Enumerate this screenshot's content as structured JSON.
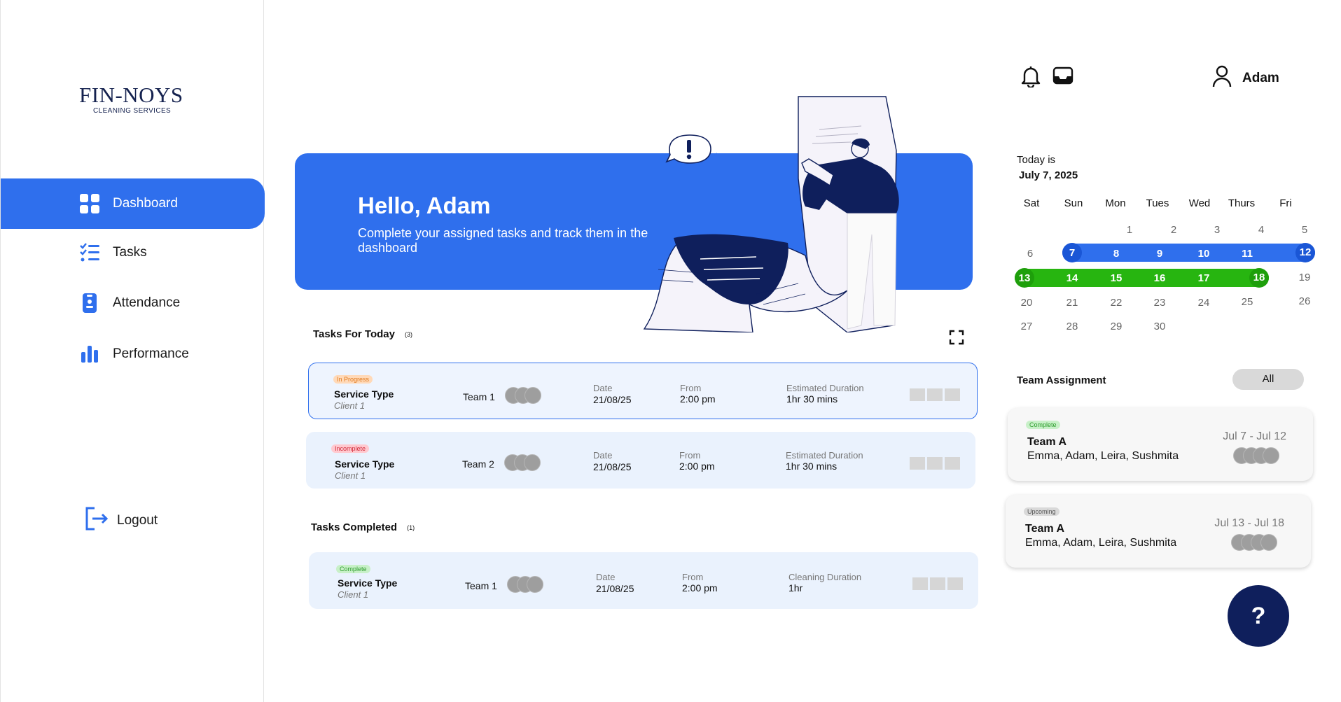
{
  "brand": {
    "name": "FIN-NOYS",
    "tagline": "CLEANING SERVICES"
  },
  "nav": [
    {
      "label": "Dashboard",
      "icon": "grid-icon",
      "active": true
    },
    {
      "label": "Tasks",
      "icon": "checklist-icon"
    },
    {
      "label": "Attendance",
      "icon": "clipboard-icon"
    },
    {
      "label": "Performance",
      "icon": "bar-chart-icon"
    }
  ],
  "logout_label": "Logout",
  "user": {
    "name": "Adam"
  },
  "hero": {
    "greeting": "Hello, Adam",
    "message": "Complete your assigned tasks and track them in the dashboard"
  },
  "tasks_today": {
    "title": "Tasks For Today",
    "count": "(3)",
    "items": [
      {
        "status": "In Progress",
        "service": "Service Type",
        "client": "Client 1",
        "team": "Team 1",
        "date_label": "Date",
        "date": "21/08/25",
        "from_label": "From",
        "from": "2:00 pm",
        "duration_label": "Estimated Duration",
        "duration": "1hr 30 mins"
      },
      {
        "status": "Incomplete",
        "service": "Service Type",
        "client": "Client 1",
        "team": "Team 2",
        "date_label": "Date",
        "date": "21/08/25",
        "from_label": "From",
        "from": "2:00 pm",
        "duration_label": "Estimated Duration",
        "duration": "1hr 30 mins"
      }
    ]
  },
  "tasks_completed": {
    "title": "Tasks Completed",
    "count": "(1)",
    "items": [
      {
        "status": "Complete",
        "service": "Service Type",
        "client": "Client 1",
        "team": "Team 1",
        "date_label": "Date",
        "date": "21/08/25",
        "from_label": "From",
        "from": "2:00 pm",
        "duration_label": "Cleaning Duration",
        "duration": "1hr"
      }
    ]
  },
  "calendar": {
    "today_label": "Today is",
    "today_date": "July 7, 2025",
    "days": [
      "Sat",
      "Sun",
      "Mon",
      "Tues",
      "Wed",
      "Thurs",
      "Fri"
    ],
    "rows": [
      [
        "",
        "",
        "1",
        "2",
        "3",
        "4",
        "5"
      ],
      [
        "6",
        "7",
        "8",
        "9",
        "10",
        "11",
        "12"
      ],
      [
        "13",
        "14",
        "15",
        "16",
        "17",
        "18",
        "19"
      ],
      [
        "20",
        "21",
        "22",
        "23",
        "24",
        "25",
        "26"
      ],
      [
        "27",
        "28",
        "29",
        "30",
        "",
        "",
        ""
      ]
    ],
    "blue_range": "7 - 12",
    "green_range": "13 - 18"
  },
  "team_assignment": {
    "title": "Team Assignment",
    "filter_label": "All",
    "cards": [
      {
        "status": "Complete",
        "team": "Team A",
        "members": "Emma, Adam, Leira, Sushmita",
        "dates": "Jul  7 - Jul 12"
      },
      {
        "status": "Upcoming",
        "team": "Team A",
        "members": "Emma, Adam, Leira, Sushmita",
        "dates": "Jul  13 - Jul 18"
      }
    ]
  },
  "help_label": "?",
  "colors": {
    "primary": "#2f6fed",
    "navy": "#0f1f5c",
    "green": "#27b510",
    "card_bg": "#eaf2fd"
  }
}
